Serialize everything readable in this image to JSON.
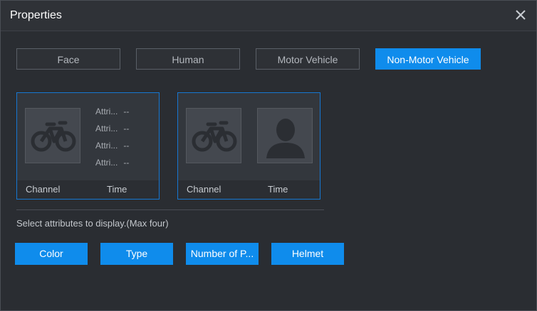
{
  "dialog": {
    "title": "Properties",
    "close_icon": "close-icon"
  },
  "tabs": [
    {
      "label": "Face",
      "active": false
    },
    {
      "label": "Human",
      "active": false
    },
    {
      "label": "Motor Vehicle",
      "active": false
    },
    {
      "label": "Non-Motor Vehicle",
      "active": true
    }
  ],
  "preview_cards": [
    {
      "image_icon": "bicycle-icon",
      "attributes": [
        {
          "label": "Attri...",
          "value": "--"
        },
        {
          "label": "Attri...",
          "value": "--"
        },
        {
          "label": "Attri...",
          "value": "--"
        },
        {
          "label": "Attri...",
          "value": "--"
        }
      ],
      "channel_label": "Channel",
      "time_label": "Time"
    },
    {
      "image_icon": "bicycle-icon",
      "person_icon": "person-silhouette-icon",
      "channel_label": "Channel",
      "time_label": "Time"
    }
  ],
  "hint": "Select attributes to display.(Max four)",
  "attribute_buttons": [
    {
      "label": "Color"
    },
    {
      "label": "Type"
    },
    {
      "label": "Number of P..."
    },
    {
      "label": "Helmet"
    }
  ],
  "colors": {
    "accent": "#0f8cec",
    "card_border": "#1677d2",
    "background": "#2a2d32"
  }
}
